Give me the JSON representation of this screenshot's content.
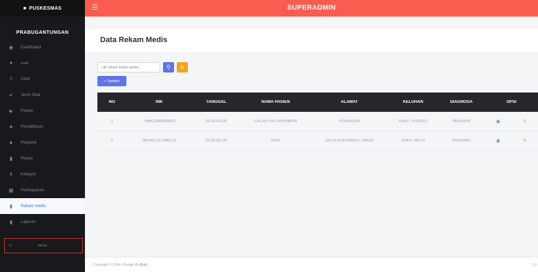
{
  "brand": {
    "name": "PUSKESMAS",
    "icon": "hospital-icon"
  },
  "org_name": "PRABUGANTUNGAN",
  "sidebar": {
    "items": [
      {
        "label": "Dashboard",
        "icon": "dashboard-icon"
      },
      {
        "label": "user",
        "icon": "users-icon"
      },
      {
        "label": "Obat",
        "icon": "pills-icon"
      },
      {
        "label": "Jenis Obat",
        "icon": "syringe-icon"
      },
      {
        "label": "Pasien",
        "icon": "patient-icon"
      },
      {
        "label": "Pendaftaran",
        "icon": "user-plus-icon"
      },
      {
        "label": "Pegawai",
        "icon": "user-tie-icon"
      },
      {
        "label": "Resep",
        "icon": "file-icon"
      },
      {
        "label": "Kategori",
        "icon": "tags-icon"
      },
      {
        "label": "Pembayaran",
        "icon": "money-icon"
      },
      {
        "label": "Rekam medis",
        "icon": "file-medical-icon",
        "active": true
      },
      {
        "label": "Laporan",
        "icon": "file-alt-icon"
      }
    ],
    "logout_label": "keluar"
  },
  "topbar": {
    "title": "SUPERADMIN"
  },
  "page": {
    "title": "Data Rekam Medis"
  },
  "search": {
    "placeholder": "cari rekam medis pasien ..."
  },
  "add_button": "+ Tambah",
  "table": {
    "headers": [
      "NO",
      "NIK",
      "TANGGAL",
      "NAMA PASIEN",
      "ALAMAT",
      "KELUHAN",
      "DIAGNOSA",
      "OPSI"
    ],
    "rows": [
      [
        "1",
        "74662288993883",
        "2019-09-28",
        "LALAN FATURAHMAN",
        "PISANGAN",
        "SAKIT PUSING",
        "MIGRAIN"
      ],
      [
        "2",
        "365497127486219",
        "2019-09-28",
        "ANIS",
        "DESA KARAWACI TIMUR",
        "SAKIT MATA",
        "MERANG"
      ]
    ]
  },
  "footer": {
    "text": "Copyright © 2024 • Design By",
    "author": "Budi",
    "version": "1.0"
  },
  "colors": {
    "topbar": "#fa5c4f",
    "sidebar": "#17191c",
    "primary": "#5f74e6",
    "warning": "#f4a11d"
  }
}
